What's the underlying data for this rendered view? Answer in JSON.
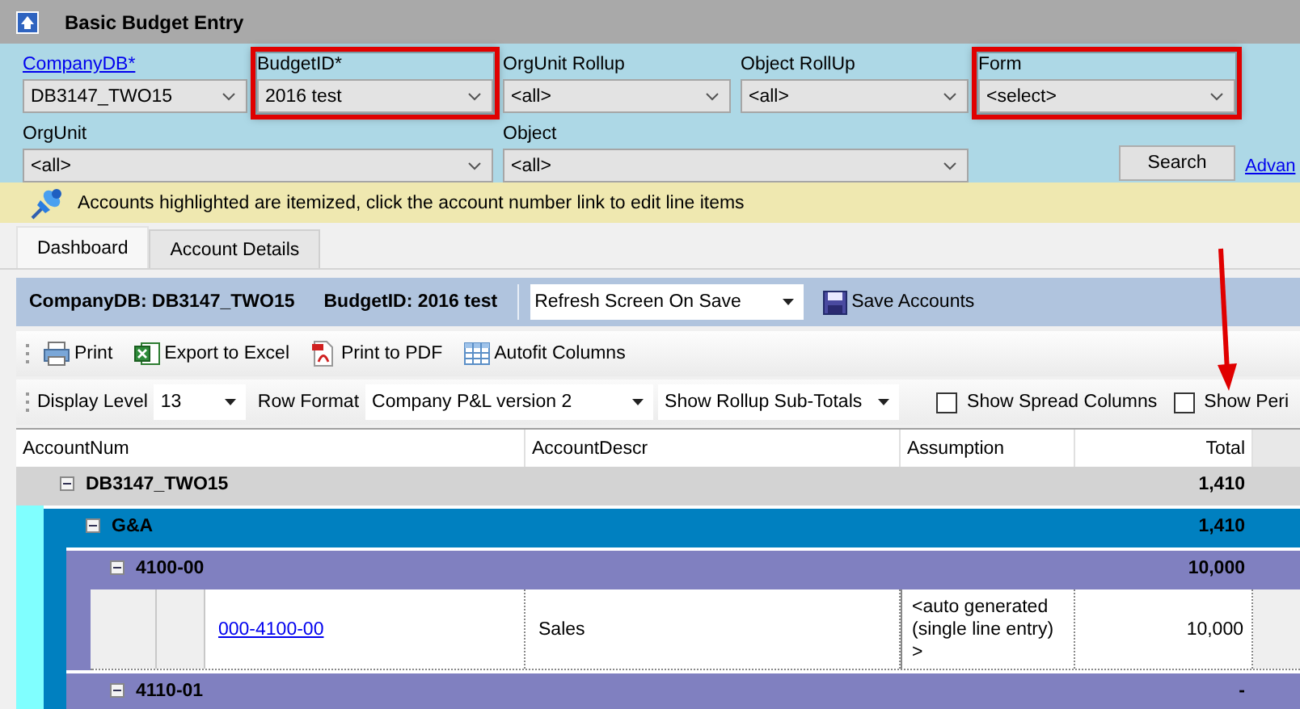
{
  "window": {
    "title": "Basic Budget Entry"
  },
  "filters": [
    {
      "label": "CompanyDB*",
      "label_is_link": true,
      "value": "DB3147_TWO15",
      "highlighted": false
    },
    {
      "label": "BudgetID*",
      "label_is_link": false,
      "value": "2016 test",
      "highlighted": true
    },
    {
      "label": "OrgUnit Rollup",
      "label_is_link": false,
      "value": "<all>",
      "highlighted": false
    },
    {
      "label": "Object RollUp",
      "label_is_link": false,
      "value": "<all>",
      "highlighted": false
    },
    {
      "label": "Form",
      "label_is_link": false,
      "value": "<select>",
      "highlighted": true
    },
    {
      "label": "OrgUnit",
      "label_is_link": false,
      "value": "<all>",
      "highlighted": false
    },
    {
      "label": "Object",
      "label_is_link": false,
      "value": "<all>",
      "highlighted": false
    }
  ],
  "search_button": "Search",
  "advanced_link": "Advan",
  "notice": "Accounts highlighted are itemized, click the account number link to edit line items",
  "tabs": [
    {
      "label": "Dashboard",
      "selected": true
    },
    {
      "label": "Account Details",
      "selected": false
    }
  ],
  "header": {
    "company": "CompanyDB: DB3147_TWO15",
    "budget": "BudgetID: 2016 test",
    "refresh_option": "Refresh Screen On Save",
    "save_button": "Save Accounts"
  },
  "toolbar": [
    {
      "kind": "print",
      "label": "Print"
    },
    {
      "kind": "excel",
      "label": "Export to Excel"
    },
    {
      "kind": "pdf",
      "label": "Print to PDF"
    },
    {
      "kind": "autofit",
      "label": "Autofit Columns"
    }
  ],
  "view_controls": [
    {
      "kind": "select",
      "label": "Display Level",
      "value": "13"
    },
    {
      "kind": "select",
      "label": "Row Format",
      "value": "Company P&L version 2"
    },
    {
      "kind": "select",
      "value": "Show Rollup Sub-Totals"
    },
    {
      "kind": "checkbox",
      "label": "Show Spread Columns",
      "checked": false
    },
    {
      "kind": "checkbox",
      "label": "Show Peri",
      "checked": false
    }
  ],
  "grid": {
    "columns": [
      "AccountNum",
      "AccountDescr",
      "Assumption",
      "Total"
    ],
    "rows": [
      {
        "kind": "group",
        "name": "DB3147_TWO15",
        "total": "1,410",
        "expanded": true,
        "children": [
          {
            "kind": "group",
            "name": "G&A",
            "total": "1,410",
            "expanded": true,
            "children": [
              {
                "kind": "group",
                "name": "4100-00",
                "total": "10,000",
                "expanded": true,
                "children": [
                  {
                    "kind": "detail",
                    "account": "000-4100-00",
                    "description": "Sales",
                    "assumption": "<auto generated (single line entry) >",
                    "total": "10,000"
                  }
                ]
              },
              {
                "kind": "group",
                "name": "4110-01",
                "total": "-",
                "expanded": true
              }
            ]
          }
        ]
      }
    ]
  },
  "callout_arrow": true
}
